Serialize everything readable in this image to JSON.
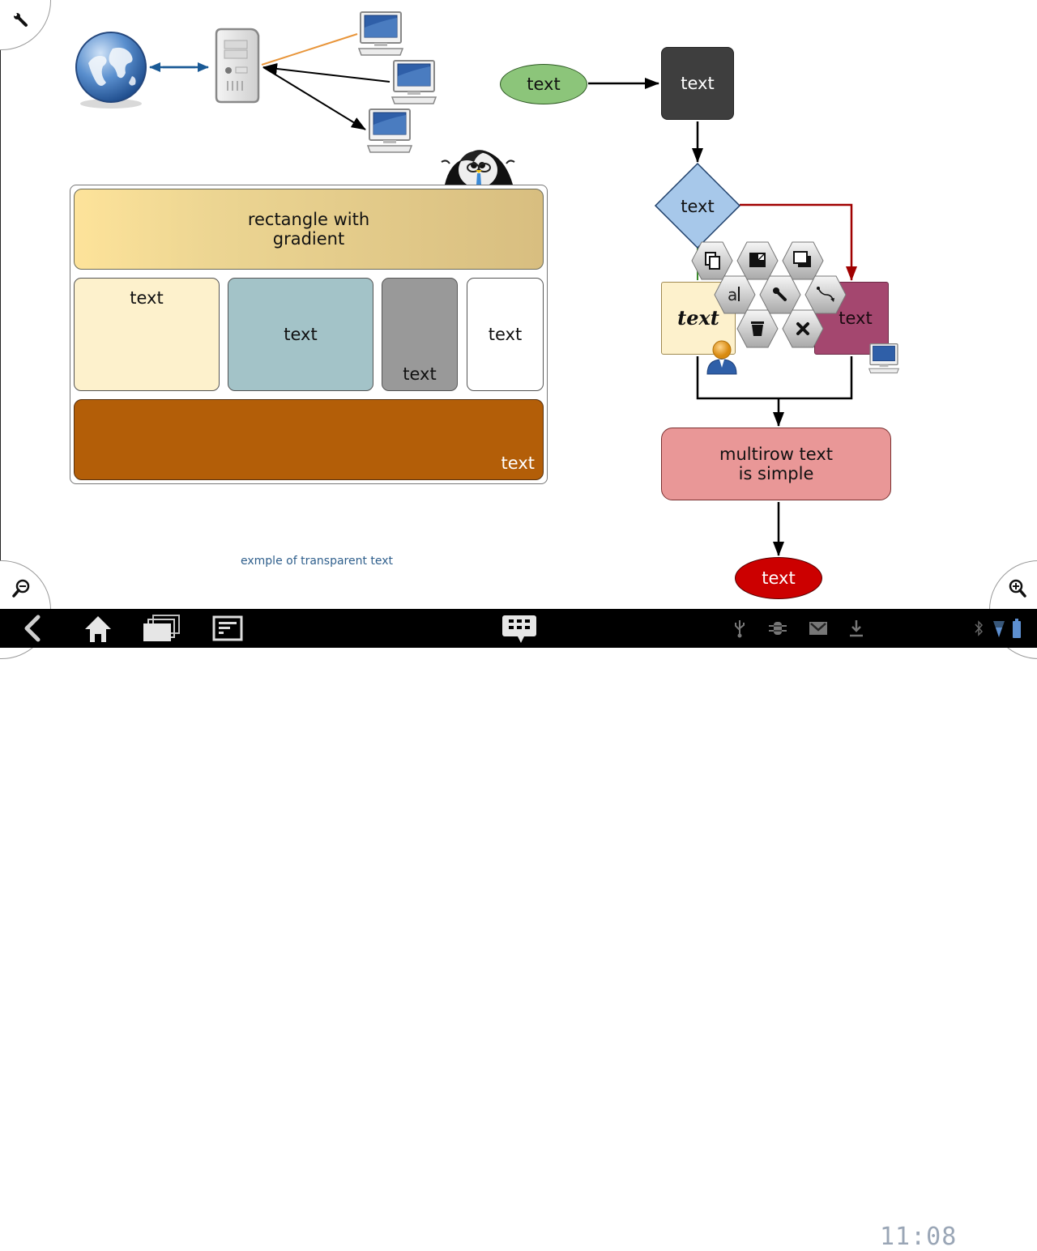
{
  "app": {
    "type": "diagram-editor"
  },
  "colors": {
    "accent_blue": "#1a5a96",
    "green_ellipse": "#8cc57a",
    "dark_box": "#3e3e3e",
    "diamond": "#a7c8ea",
    "cream_box": "#fdf1cc",
    "teal_box": "#a3c3c8",
    "gray_box": "#999999",
    "brown_box": "#b35e08",
    "magenta_box": "#a4476f",
    "pink_box": "#e99797",
    "red_ellipse": "#cc0000",
    "red_connector": "#a00000",
    "orange_line": "#e8953a"
  },
  "corner_buttons": {
    "top_left": "tools",
    "bottom_left": "zoom-out",
    "bottom_right": "zoom-in"
  },
  "network": {
    "items": [
      "globe",
      "server",
      "computer",
      "computer",
      "computer",
      "penguin"
    ]
  },
  "container": {
    "gradient_rect": "rectangle with\ngradient",
    "cream": "text",
    "teal": "text",
    "gray": "text",
    "white": "text",
    "brown": "text"
  },
  "transparent_text": "exmple of transparent text",
  "flow": {
    "green_ellipse": "text",
    "dark_box": "text",
    "diamond": "text",
    "cream_italic": "text",
    "magenta": "text",
    "pink": "multirow text\nis simple",
    "red_ellipse": "text"
  },
  "hex_menu": [
    {
      "name": "copy",
      "label": "copy"
    },
    {
      "name": "resize",
      "label": "resize"
    },
    {
      "name": "bring-to-front",
      "label": "bring to front"
    },
    {
      "name": "edit-text",
      "label": "a|"
    },
    {
      "name": "properties",
      "label": "properties"
    },
    {
      "name": "connect",
      "label": "connect"
    },
    {
      "name": "delete",
      "label": "delete"
    },
    {
      "name": "close",
      "label": "close"
    }
  ],
  "navbar": {
    "buttons": [
      "back",
      "home",
      "recent-apps",
      "menu",
      "keyboard"
    ],
    "status": {
      "time": "11:08",
      "icons": [
        "usb",
        "debug",
        "gmail",
        "download",
        "bluetooth",
        "wifi",
        "battery"
      ]
    }
  }
}
